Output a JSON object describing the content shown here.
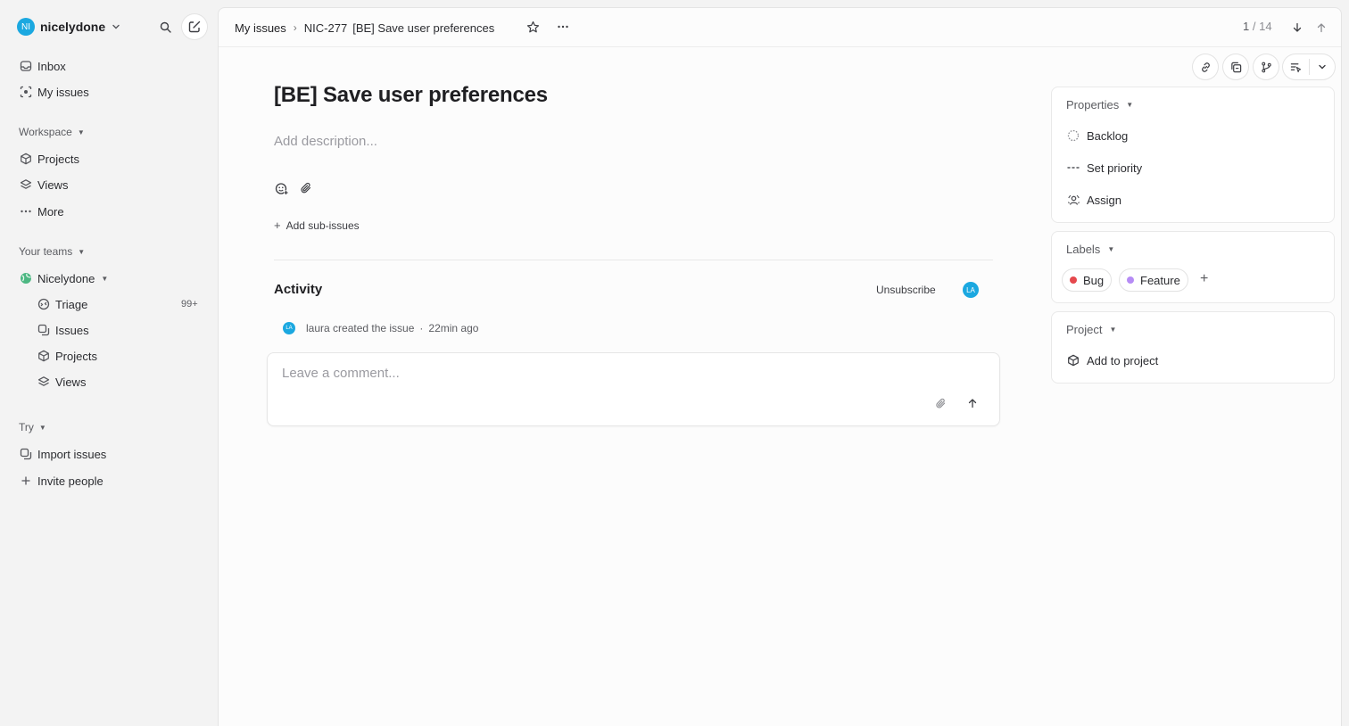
{
  "workspace": {
    "initials": "NI",
    "name": "nicelydone"
  },
  "sidebar": {
    "top_items": [
      {
        "label": "Inbox"
      },
      {
        "label": "My issues"
      }
    ],
    "workspace_section": "Workspace",
    "workspace_items": [
      {
        "label": "Projects"
      },
      {
        "label": "Views"
      },
      {
        "label": "More"
      }
    ],
    "teams_section": "Your teams",
    "team": {
      "label": "Nicelydone"
    },
    "team_items": [
      {
        "label": "Triage",
        "badge": "99+"
      },
      {
        "label": "Issues"
      },
      {
        "label": "Projects"
      },
      {
        "label": "Views"
      }
    ],
    "try_section": "Try",
    "try_items": [
      {
        "label": "Import issues"
      },
      {
        "label": "Invite people"
      }
    ]
  },
  "breadcrumb": {
    "parent": "My issues",
    "separator": "›",
    "id": "NIC-277",
    "title": "[BE] Save user preferences"
  },
  "pager": {
    "current": "1",
    "total": "/ 14"
  },
  "issue": {
    "title": "[BE] Save user preferences",
    "description_placeholder": "Add description...",
    "add_sub_issues": "Add sub-issues"
  },
  "activity": {
    "heading": "Activity",
    "unsubscribe": "Unsubscribe",
    "avatar": "LA",
    "event": {
      "avatar": "LA",
      "text": "laura created the issue",
      "dot": "·",
      "time": "22min ago"
    },
    "comment_placeholder": "Leave a comment..."
  },
  "properties": {
    "heading": "Properties",
    "status": "Backlog",
    "priority": "Set priority",
    "assignee": "Assign"
  },
  "labels": {
    "heading": "Labels",
    "items": [
      {
        "name": "Bug",
        "color": "#e5484d"
      },
      {
        "name": "Feature",
        "color": "#b68cf5"
      }
    ],
    "add": "+"
  },
  "project": {
    "heading": "Project",
    "add": "Add to project"
  },
  "colors": {
    "accent": "#1ba8e0",
    "sidebar_bg": "#f3f3f3",
    "main_bg": "#fcfcfc"
  }
}
